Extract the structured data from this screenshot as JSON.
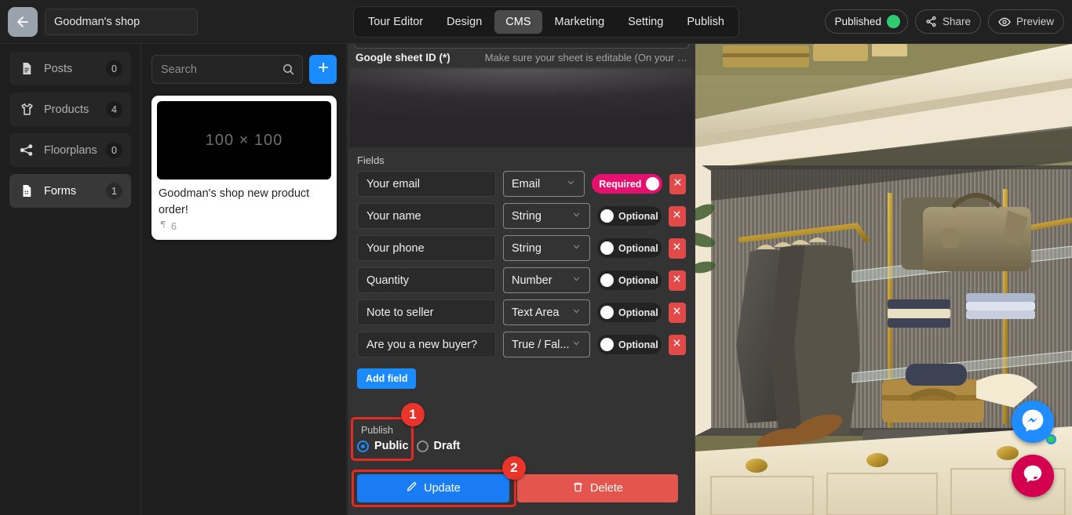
{
  "topbar": {
    "back_icon": "arrow-left-icon",
    "project_title": "Goodman's shop",
    "project_title_placeholder": "Project name",
    "tabs": [
      {
        "label": "Tour Editor",
        "active": false
      },
      {
        "label": "Design",
        "active": false
      },
      {
        "label": "CMS",
        "active": true
      },
      {
        "label": "Marketing",
        "active": false
      },
      {
        "label": "Setting",
        "active": false
      },
      {
        "label": "Publish",
        "active": false
      }
    ],
    "status_label": "Published",
    "status_color": "#2fcc6f",
    "share_label": "Share",
    "share_icon": "share-icon",
    "preview_label": "Preview",
    "preview_icon": "eye-icon"
  },
  "sidebar": {
    "items": [
      {
        "label": "Posts",
        "count": "0",
        "icon": "document-icon",
        "active": false
      },
      {
        "label": "Products",
        "count": "4",
        "icon": "tshirt-icon",
        "active": false
      },
      {
        "label": "Floorplans",
        "count": "0",
        "icon": "floorplan-icon",
        "active": false
      },
      {
        "label": "Forms",
        "count": "1",
        "icon": "form-icon",
        "active": true
      }
    ]
  },
  "list_panel": {
    "search_placeholder": "Search",
    "search_value": "",
    "search_icon": "search-icon",
    "add_icon": "plus-icon",
    "cards": [
      {
        "thumb_text": "100 × 100",
        "title": "Goodman's shop new product order!",
        "meta_icon": "paragraph-icon",
        "meta_count": "6"
      }
    ]
  },
  "form_panel": {
    "google_sheet_label": "Google sheet ID (*)",
    "google_sheet_hint": "Make sure your sheet is editable (On your sh...",
    "fields_label": "Fields",
    "fields": [
      {
        "name": "Your email",
        "type": "Email",
        "toggle": "Required",
        "required": true,
        "remove_icon": "close-icon"
      },
      {
        "name": "Your name",
        "type": "String",
        "toggle": "Optional",
        "required": false,
        "remove_icon": "close-icon"
      },
      {
        "name": "Your phone",
        "type": "String",
        "toggle": "Optional",
        "required": false,
        "remove_icon": "close-icon"
      },
      {
        "name": "Quantity",
        "type": "Number",
        "toggle": "Optional",
        "required": false,
        "remove_icon": "close-icon"
      },
      {
        "name": "Note to seller",
        "type": "Text Area",
        "toggle": "Optional",
        "required": false,
        "remove_icon": "close-icon"
      },
      {
        "name": "Are you a new buyer?",
        "type": "True / Fal...",
        "toggle": "Optional",
        "required": false,
        "remove_icon": "close-icon"
      }
    ],
    "add_field_label": "Add field",
    "publish_label": "Publish",
    "publish_options": [
      {
        "label": "Public",
        "selected": true
      },
      {
        "label": "Draft",
        "selected": false
      }
    ],
    "update_label": "Update",
    "update_icon": "pencil-icon",
    "delete_label": "Delete",
    "delete_icon": "trash-icon",
    "annotations": [
      {
        "number": "1",
        "target": "publish-radio-group"
      },
      {
        "number": "2",
        "target": "update-button"
      }
    ],
    "highlight_color": "#e42a22",
    "accent_blue": "#1a8cff",
    "required_pink": "#e6106e",
    "danger_red": "#e24a4a"
  },
  "preview_panel": {
    "scene_description": "360 tour of a menswear boutique interior with hanging suits, leather bags, folded shirts and shoes on glass shelving",
    "widgets": [
      {
        "name": "messenger-chat-button",
        "icon": "messenger-icon",
        "color": "#1f8cff",
        "online": true
      },
      {
        "name": "live-chat-button",
        "icon": "chat-bubble-icon",
        "color": "#d2004f",
        "online": false
      }
    ]
  }
}
